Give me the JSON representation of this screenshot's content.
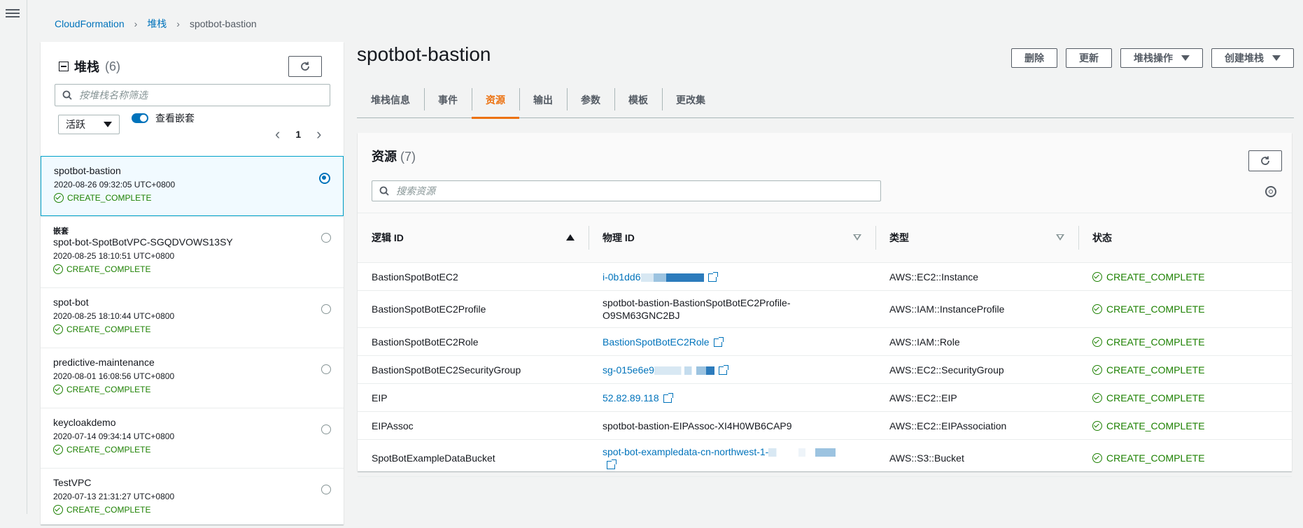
{
  "breadcrumb": {
    "root": "CloudFormation",
    "stacks": "堆栈",
    "current": "spotbot-bastion"
  },
  "left_panel": {
    "title": "堆栈",
    "count": "(6)",
    "search_placeholder": "按堆栈名称筛选",
    "filter_value": "活跃",
    "toggle_label": "查看嵌套",
    "page": "1",
    "stacks": [
      {
        "name": "spotbot-bastion",
        "nested": "",
        "date": "2020-08-26 09:32:05 UTC+0800",
        "status": "CREATE_COMPLETE",
        "selected": true
      },
      {
        "name": "spot-bot-SpotBotVPC-SGQDVOWS13SY",
        "nested": "嵌套",
        "date": "2020-08-25 18:10:51 UTC+0800",
        "status": "CREATE_COMPLETE",
        "selected": false
      },
      {
        "name": "spot-bot",
        "nested": "",
        "date": "2020-08-25 18:10:44 UTC+0800",
        "status": "CREATE_COMPLETE",
        "selected": false
      },
      {
        "name": "predictive-maintenance",
        "nested": "",
        "date": "2020-08-01 16:08:56 UTC+0800",
        "status": "CREATE_COMPLETE",
        "selected": false
      },
      {
        "name": "keycloakdemo",
        "nested": "",
        "date": "2020-07-14 09:34:14 UTC+0800",
        "status": "CREATE_COMPLETE",
        "selected": false
      },
      {
        "name": "TestVPC",
        "nested": "",
        "date": "2020-07-13 21:31:27 UTC+0800",
        "status": "CREATE_COMPLETE",
        "selected": false
      }
    ]
  },
  "main": {
    "title": "spotbot-bastion",
    "actions": {
      "delete": "删除",
      "update": "更新",
      "stack_actions": "堆栈操作",
      "create_stack": "创建堆栈"
    },
    "tabs": [
      "堆栈信息",
      "事件",
      "资源",
      "输出",
      "参数",
      "模板",
      "更改集"
    ],
    "active_tab": "资源"
  },
  "resources": {
    "title": "资源",
    "count": "(7)",
    "search_placeholder": "搜索资源",
    "columns": [
      "逻辑 ID",
      "物理 ID",
      "类型",
      "状态"
    ],
    "rows": [
      {
        "logical_id": "BastionSpotBotEC2",
        "physical_id": "i-0b1dd6",
        "physical_link": true,
        "redacted": true,
        "type": "AWS::EC2::Instance",
        "status": "CREATE_COMPLETE"
      },
      {
        "logical_id": "BastionSpotBotEC2Profile",
        "physical_id": "spotbot-bastion-BastionSpotBotEC2Profile-O9SM63GNC2BJ",
        "physical_link": false,
        "redacted": false,
        "type": "AWS::IAM::InstanceProfile",
        "status": "CREATE_COMPLETE"
      },
      {
        "logical_id": "BastionSpotBotEC2Role",
        "physical_id": "BastionSpotBotEC2Role",
        "physical_link": true,
        "redacted": false,
        "type": "AWS::IAM::Role",
        "status": "CREATE_COMPLETE"
      },
      {
        "logical_id": "BastionSpotBotEC2SecurityGroup",
        "physical_id": "sg-015e6e9",
        "physical_link": true,
        "redacted": true,
        "type": "AWS::EC2::SecurityGroup",
        "status": "CREATE_COMPLETE"
      },
      {
        "logical_id": "EIP",
        "physical_id": "52.82.89.118",
        "physical_link": true,
        "redacted": false,
        "type": "AWS::EC2::EIP",
        "status": "CREATE_COMPLETE"
      },
      {
        "logical_id": "EIPAssoc",
        "physical_id": "spotbot-bastion-EIPAssoc-XI4H0WB6CAP9",
        "physical_link": false,
        "redacted": false,
        "type": "AWS::EC2::EIPAssociation",
        "status": "CREATE_COMPLETE"
      },
      {
        "logical_id": "SpotBotExampleDataBucket",
        "physical_id": "spot-bot-exampledata-cn-northwest-1-",
        "physical_link": true,
        "redacted": true,
        "type": "AWS::S3::Bucket",
        "status": "CREATE_COMPLETE"
      }
    ]
  },
  "colors": {
    "link": "#0073bb",
    "accent": "#ec7211",
    "success": "#1d8102"
  }
}
